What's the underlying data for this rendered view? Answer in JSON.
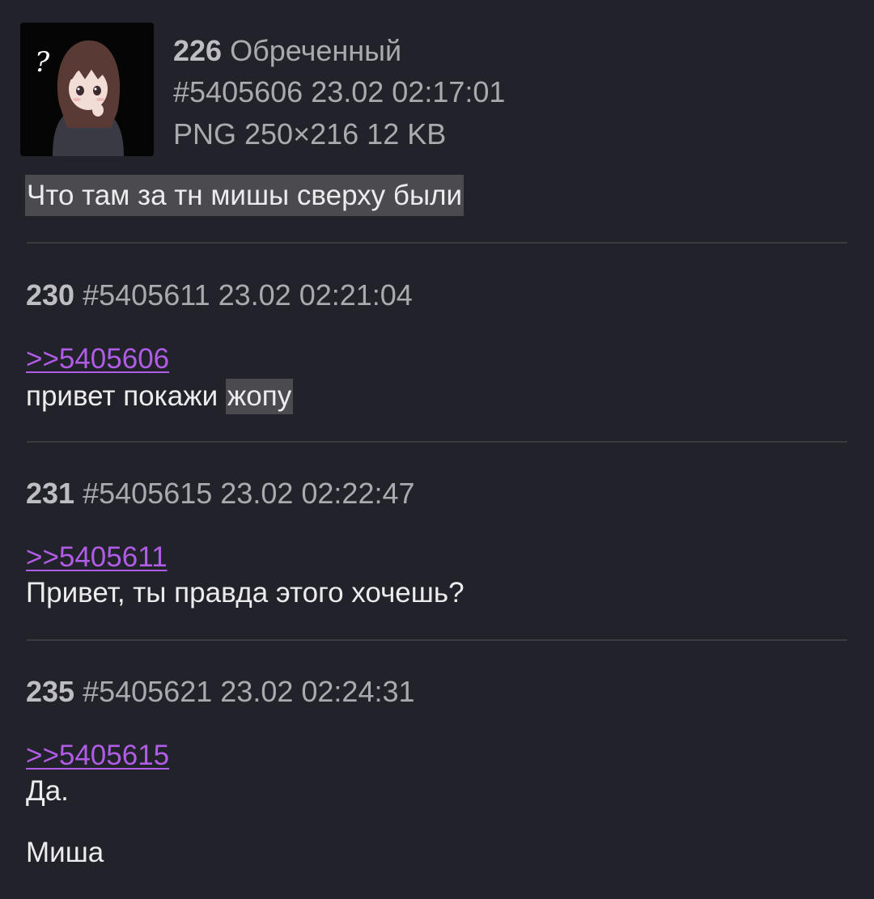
{
  "op": {
    "post_index": "226",
    "author_name": "Обреченный",
    "post_id": "#5405606",
    "datetime": "23.02 02:17:01",
    "file_info": "PNG 250×216 12 KB",
    "thumbnail_icon": "anime-girl-avatar-icon",
    "body": "Что там за тн мишы сверху были"
  },
  "replies": [
    {
      "post_index": "230",
      "post_id": "#5405611",
      "datetime": "23.02 02:21:04",
      "quote_link": ">>5405606",
      "body_plain": "привет покажи ",
      "body_highlight": "жопу"
    },
    {
      "post_index": "231",
      "post_id": "#5405615",
      "datetime": "23.02 02:22:47",
      "quote_link": ">>5405611",
      "body": "Привет, ты правда этого хочешь?"
    },
    {
      "post_index": "235",
      "post_id": "#5405621",
      "datetime": "23.02 02:24:31",
      "quote_link": ">>5405615",
      "body_line1": "Да.",
      "body_line2": "Миша"
    }
  ],
  "colors": {
    "background": "#22222a",
    "link": "#b05ce6",
    "highlight": "#4a4a4f",
    "divider": "#3b3b42"
  }
}
